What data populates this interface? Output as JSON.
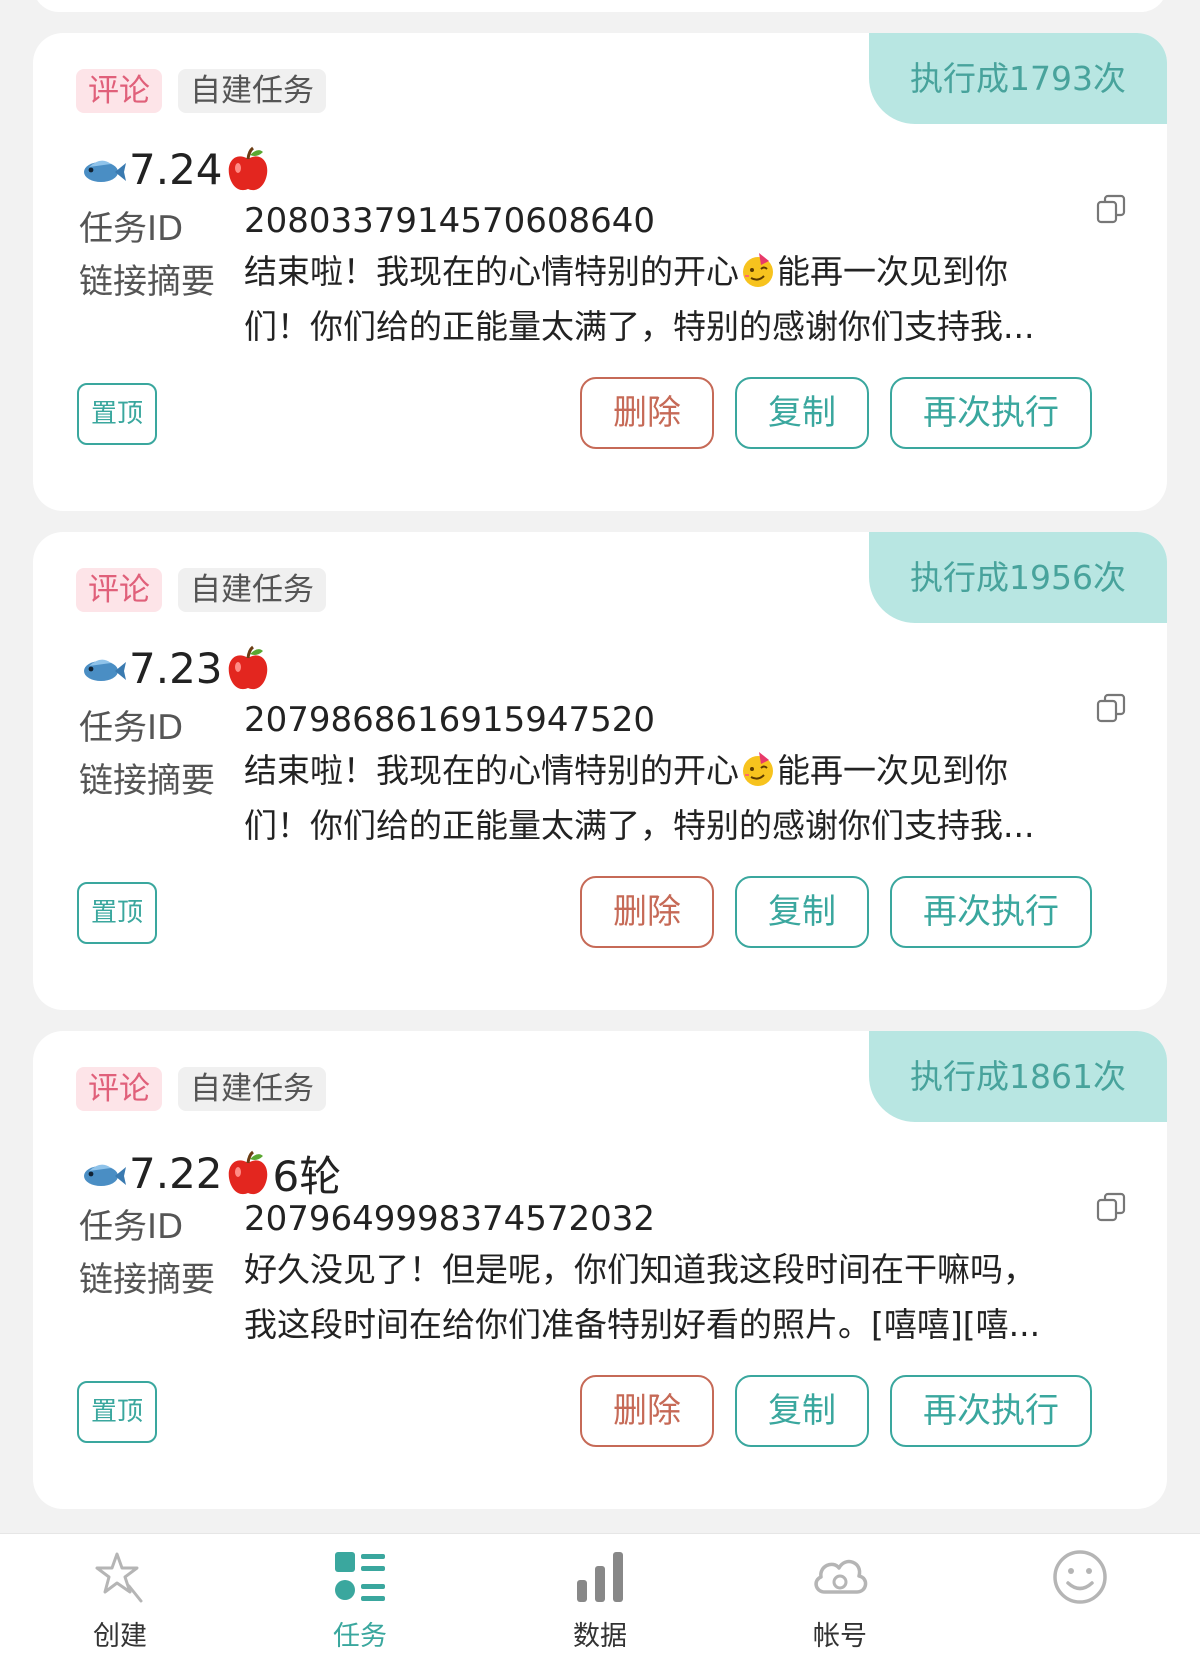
{
  "labels": {
    "task_id": "任务ID",
    "link_summary": "链接摘要",
    "pin": "置顶",
    "delete": "删除",
    "copy": "复制",
    "rerun": "再次执行"
  },
  "tasks": [
    {
      "exec_count_text": "执行成1793次",
      "type_tag": "评论",
      "source_tag": "自建任务",
      "title_number": "7.24",
      "title_suffix": "",
      "task_id": "2080337914570608640",
      "summary_line1_pre": "结束啦！我现在的心情特别的开心",
      "summary_line1_post": "能再一次见到你",
      "summary_line2": "们！你们给的正能量太满了，特别的感谢你们支持我..."
    },
    {
      "exec_count_text": "执行成1956次",
      "type_tag": "评论",
      "source_tag": "自建任务",
      "title_number": "7.23",
      "title_suffix": "",
      "task_id": "2079868616915947520",
      "summary_line1_pre": "结束啦！我现在的心情特别的开心",
      "summary_line1_post": "能再一次见到你",
      "summary_line2": "们！你们给的正能量太满了，特别的感谢你们支持我..."
    },
    {
      "exec_count_text": "执行成1861次",
      "type_tag": "评论",
      "source_tag": "自建任务",
      "title_number": "7.22",
      "title_suffix": "6轮",
      "task_id": "2079649998374572032",
      "summary_line1_pre": "好久没见了！但是呢，你们知道我这段时间在干嘛吗，",
      "summary_line1_post": "",
      "summary_line2": "我这段时间在给你们准备特别好看的照片。[嘻嘻][嘻..."
    }
  ],
  "nav": [
    {
      "label": "创建",
      "icon": "star-sparkle-icon",
      "active": false
    },
    {
      "label": "任务",
      "icon": "task-list-icon",
      "active": true
    },
    {
      "label": "数据",
      "icon": "bar-chart-icon",
      "active": false
    },
    {
      "label": "帐号",
      "icon": "cloud-account-icon",
      "active": false
    },
    {
      "label": "",
      "icon": "smiley-icon",
      "active": false
    }
  ],
  "colors": {
    "accent": "#3aa79e",
    "badge_bg": "#b8e6e2",
    "delete": "#c66a57",
    "comment_tag": "#e0607a"
  }
}
